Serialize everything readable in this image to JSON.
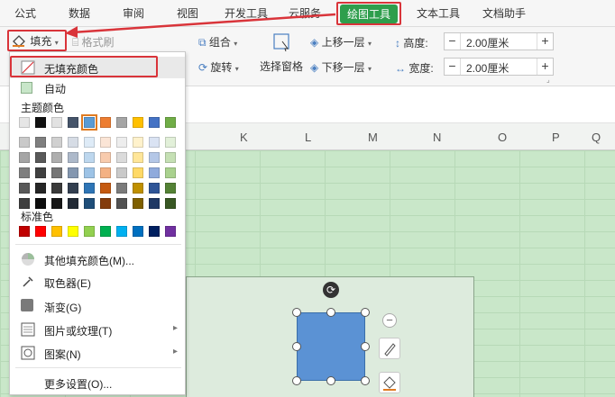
{
  "tabs": [
    "公式",
    "数据",
    "审阅",
    "视图",
    "开发工具",
    "云服务",
    "绘图工具",
    "文本工具",
    "文档助手"
  ],
  "ribbon": {
    "fill_label": "填充",
    "format_painter_label": "格式刷",
    "group_label": "组合",
    "rotate_label": "旋转",
    "selection_pane_label": "选择窗格",
    "bring_forward_label": "上移一层",
    "send_backward_label": "下移一层",
    "height_label": "高度:",
    "width_label": "宽度:",
    "height_value": "2.00厘米",
    "width_value": "2.00厘米",
    "minus": "−",
    "plus": "+"
  },
  "columns": [
    "K",
    "L",
    "M",
    "N",
    "O",
    "P",
    "Q"
  ],
  "fill_menu": {
    "no_fill": "无填充颜色",
    "auto": "自动",
    "theme_colors_title": "主题颜色",
    "standard_colors_title": "标准色",
    "more_colors": "其他填充颜色(M)...",
    "eyedropper": "取色器(E)",
    "gradient": "渐变(G)",
    "picture_texture": "图片或纹理(T)",
    "pattern": "图案(N)",
    "more_settings": "更多设置(O)...",
    "theme_top_row": [
      "#e6e6e6",
      "#111111",
      "#e2e2e2",
      "#45546a",
      "#5b9bd5",
      "#ed7d31",
      "#a5a5a5",
      "#ffc000",
      "#4472c4",
      "#70ad47"
    ],
    "theme_shades": [
      [
        "#c9c9c9",
        "#7f7f7f",
        "#d0d0d0",
        "#d6dce5",
        "#deebf7",
        "#fbe5d6",
        "#ededed",
        "#fff2cc",
        "#dae3f3",
        "#e2f0d9"
      ],
      [
        "#a5a5a5",
        "#595959",
        "#aeaeae",
        "#adb9ca",
        "#bdd7ee",
        "#f8cbad",
        "#dbdbdb",
        "#ffe699",
        "#b4c7e7",
        "#c5e0b4"
      ],
      [
        "#7f7f7f",
        "#404040",
        "#757575",
        "#8497b0",
        "#9dc3e6",
        "#f4b183",
        "#c9c9c9",
        "#ffd966",
        "#8faadc",
        "#a9d18e"
      ],
      [
        "#595959",
        "#262626",
        "#3a3a3a",
        "#333f50",
        "#2e75b6",
        "#c55a11",
        "#7b7b7b",
        "#bf9000",
        "#2f5597",
        "#548235"
      ],
      [
        "#3f3f3f",
        "#0d0d0d",
        "#171717",
        "#222a35",
        "#1f4e79",
        "#843c0c",
        "#525252",
        "#7f6000",
        "#1f3864",
        "#385723"
      ]
    ],
    "standard_colors": [
      "#c00000",
      "#ff0000",
      "#ffc000",
      "#ffff00",
      "#92d050",
      "#00b050",
      "#00b0f0",
      "#0070c0",
      "#002060",
      "#7030a0"
    ],
    "highlight_color": "#5b9bd5"
  },
  "shape": {
    "fill_color": "#5b92d4"
  },
  "colors": {
    "accent_green": "#2e9e4c",
    "annotation_red": "#d9343a"
  }
}
